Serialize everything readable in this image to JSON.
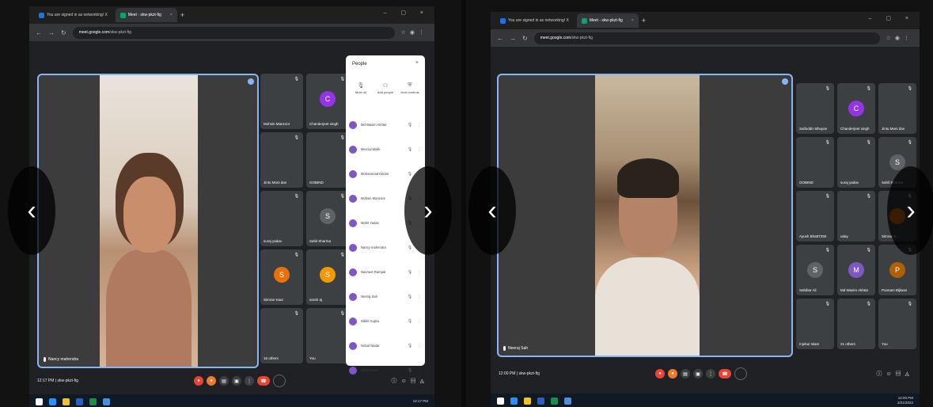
{
  "panel1": {
    "tabs": [
      {
        "label": "You are signed in as networking/ X"
      },
      {
        "label": "Meet - skw-pkzt-fig"
      }
    ],
    "url_domain": "meet.google.com",
    "url_path": "/skw-pkzt-fig",
    "main_speaker": "Nancy mahendra",
    "meeting_time": "12:17 PM",
    "meeting_code": "skw-pkzt-fig",
    "grid": [
      {
        "name": "Mohsin Manzoor",
        "initial": "",
        "color": "#3c4043"
      },
      {
        "name": "Chanderjeet singh",
        "initial": "C",
        "color": "#9334e6"
      },
      {
        "name": "Jintu Moni das",
        "initial": "",
        "color": "#3c4043"
      },
      {
        "name": "GOBIND",
        "initial": "",
        "color": "#3c4043"
      },
      {
        "name": "suraj yadav",
        "initial": "",
        "color": "#3c4043"
      },
      {
        "name": "Sahil Sharma",
        "initial": "S",
        "color": "#5f6368"
      },
      {
        "name": "Simran Kaur",
        "initial": "S",
        "color": "#e8710a"
      },
      {
        "name": "sarah aj",
        "initial": "S",
        "color": "#f29900"
      },
      {
        "name": "15 others",
        "initial": "",
        "color": "#3c4043"
      },
      {
        "name": "You",
        "initial": "",
        "color": "#3c4043"
      }
    ],
    "people": {
      "title": "People",
      "actions": [
        "Mute all",
        "Add people",
        "Host controls"
      ],
      "list": [
        "Md Wasim Akhtar",
        "Mercial Malik",
        "Mohammad Akram",
        "Mohsin Manzoor",
        "Mohit Yadav",
        "Nancy mahendra",
        "Navneet Rampal",
        "Neeraj Sah",
        "Nikhil Gupta",
        "Nobal Nadar",
        "Noha Khan"
      ]
    },
    "tray_time": "12:17 PM"
  },
  "panel2": {
    "tabs": [
      {
        "label": "You are signed in as networking/ X"
      },
      {
        "label": "Meet - skw-pkzt-fig"
      }
    ],
    "url_domain": "meet.google.com",
    "url_path": "/skw-pkzt-fig",
    "main_speaker": "Neeraj Sah",
    "meeting_time": "12:00 PM",
    "meeting_code": "skw-pkzt-fig",
    "grid": [
      {
        "name": "Saifuddin Bhuyan",
        "initial": "",
        "color": "#3c4043"
      },
      {
        "name": "Chanderjeet singh",
        "initial": "C",
        "color": "#9334e6"
      },
      {
        "name": "Jintu Moni das",
        "initial": "",
        "color": "#3c4043"
      },
      {
        "name": "GOBIND",
        "initial": "",
        "color": "#3c4043"
      },
      {
        "name": "suraj yadav",
        "initial": "",
        "color": "#3c4043"
      },
      {
        "name": "Sahil Sharma",
        "initial": "S",
        "color": "#5f6368"
      },
      {
        "name": "Ayush Bhatt7290",
        "initial": "",
        "color": "#3c4043"
      },
      {
        "name": "uday",
        "initial": "",
        "color": "#3c4043"
      },
      {
        "name": "Simran K...",
        "initial": "",
        "color": "#e8710a"
      },
      {
        "name": "Sahibar Ali",
        "initial": "S",
        "color": "#5f6368"
      },
      {
        "name": "Md Wasim Akhtar",
        "initial": "M",
        "color": "#7e57c2"
      },
      {
        "name": "Poonam Bijlwan",
        "initial": "P",
        "color": "#b06000"
      },
      {
        "name": "Injebul Islam",
        "initial": "",
        "color": "#3c4043"
      },
      {
        "name": "21 others",
        "initial": "",
        "color": "#3c4043"
      },
      {
        "name": "You",
        "initial": "",
        "color": "#3c4043"
      }
    ],
    "tray_time": "12:00 PM",
    "tray_date": "2/21/2022"
  },
  "nav": {
    "prev": "‹",
    "next": "›"
  }
}
